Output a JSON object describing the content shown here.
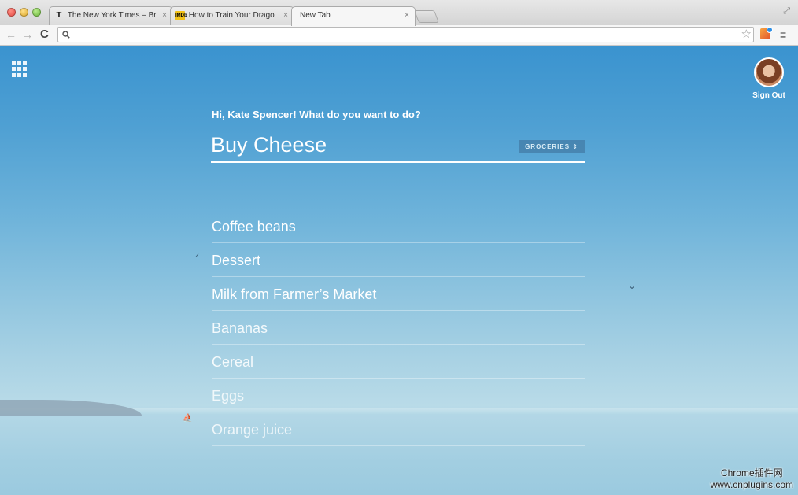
{
  "browser": {
    "tabs": [
      {
        "favicon": "nyt-icon",
        "glyph": "T",
        "title": "The New York Times – Bre",
        "active": false
      },
      {
        "favicon": "imdb-icon",
        "glyph": "IMDb",
        "title": "How to Train Your Dragon",
        "active": false
      },
      {
        "favicon": "",
        "glyph": "",
        "title": "New Tab",
        "active": true
      }
    ],
    "tab_close_glyph": "×",
    "address": "",
    "nav": {
      "back": "←",
      "forward": "→",
      "reload": "C"
    }
  },
  "page": {
    "greeting": "Hi, Kate Spencer! What do you want to do?",
    "input_value": "Buy Cheese",
    "list_tag": "GROCERIES ⇕",
    "sign_out": "Sign Out",
    "tasks": [
      "Coffee beans",
      "Dessert",
      "Milk from Farmer’s Market",
      "Bananas",
      "Cereal",
      "Eggs",
      "Orange juice"
    ]
  },
  "watermark": {
    "line1": "Chrome插件网",
    "line2": "www.cnplugins.com"
  },
  "colors": {
    "sky_top": "#3a93cf",
    "sky_bottom": "#b9dbe8",
    "text": "#ffffff"
  }
}
